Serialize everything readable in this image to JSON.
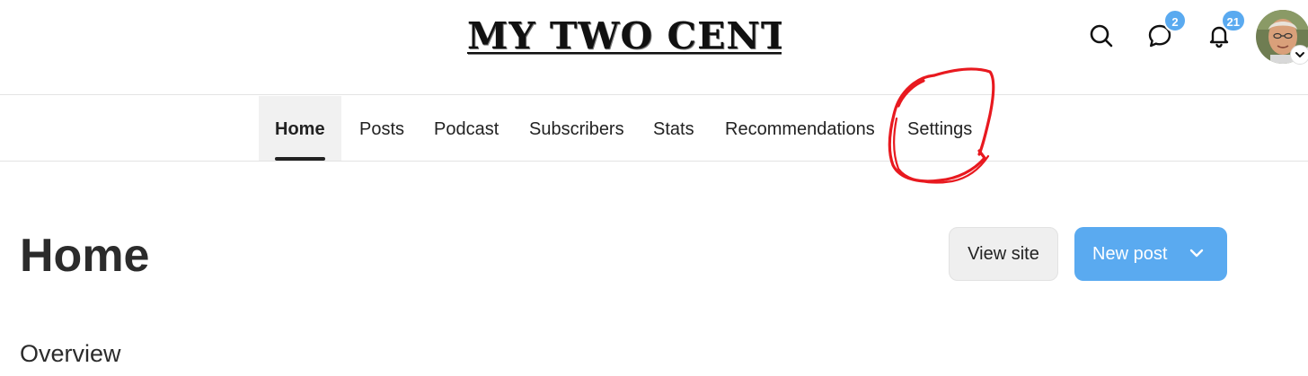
{
  "header": {
    "logo_text": "MY TWO CENTS",
    "search_icon": "search-icon",
    "messages": {
      "icon": "chat-bubble-icon",
      "badge": "2"
    },
    "notifications": {
      "icon": "bell-icon",
      "badge": "21"
    },
    "avatar": {
      "icon": "user-avatar",
      "menu_icon": "chevron-down-icon"
    }
  },
  "tabs": [
    {
      "label": "Home",
      "active": true
    },
    {
      "label": "Posts",
      "active": false
    },
    {
      "label": "Podcast",
      "active": false
    },
    {
      "label": "Subscribers",
      "active": false
    },
    {
      "label": "Stats",
      "active": false
    },
    {
      "label": "Recommendations",
      "active": false
    },
    {
      "label": "Settings",
      "active": false
    }
  ],
  "annotation": {
    "color": "#e8191f",
    "target": "Settings"
  },
  "main": {
    "title": "Home",
    "view_site_label": "View site",
    "new_post_label": "New post",
    "overview_label": "Overview"
  },
  "colors": {
    "accent": "#5aaaf0",
    "tab_active_bg": "#f1f1f1",
    "text": "#222222"
  }
}
